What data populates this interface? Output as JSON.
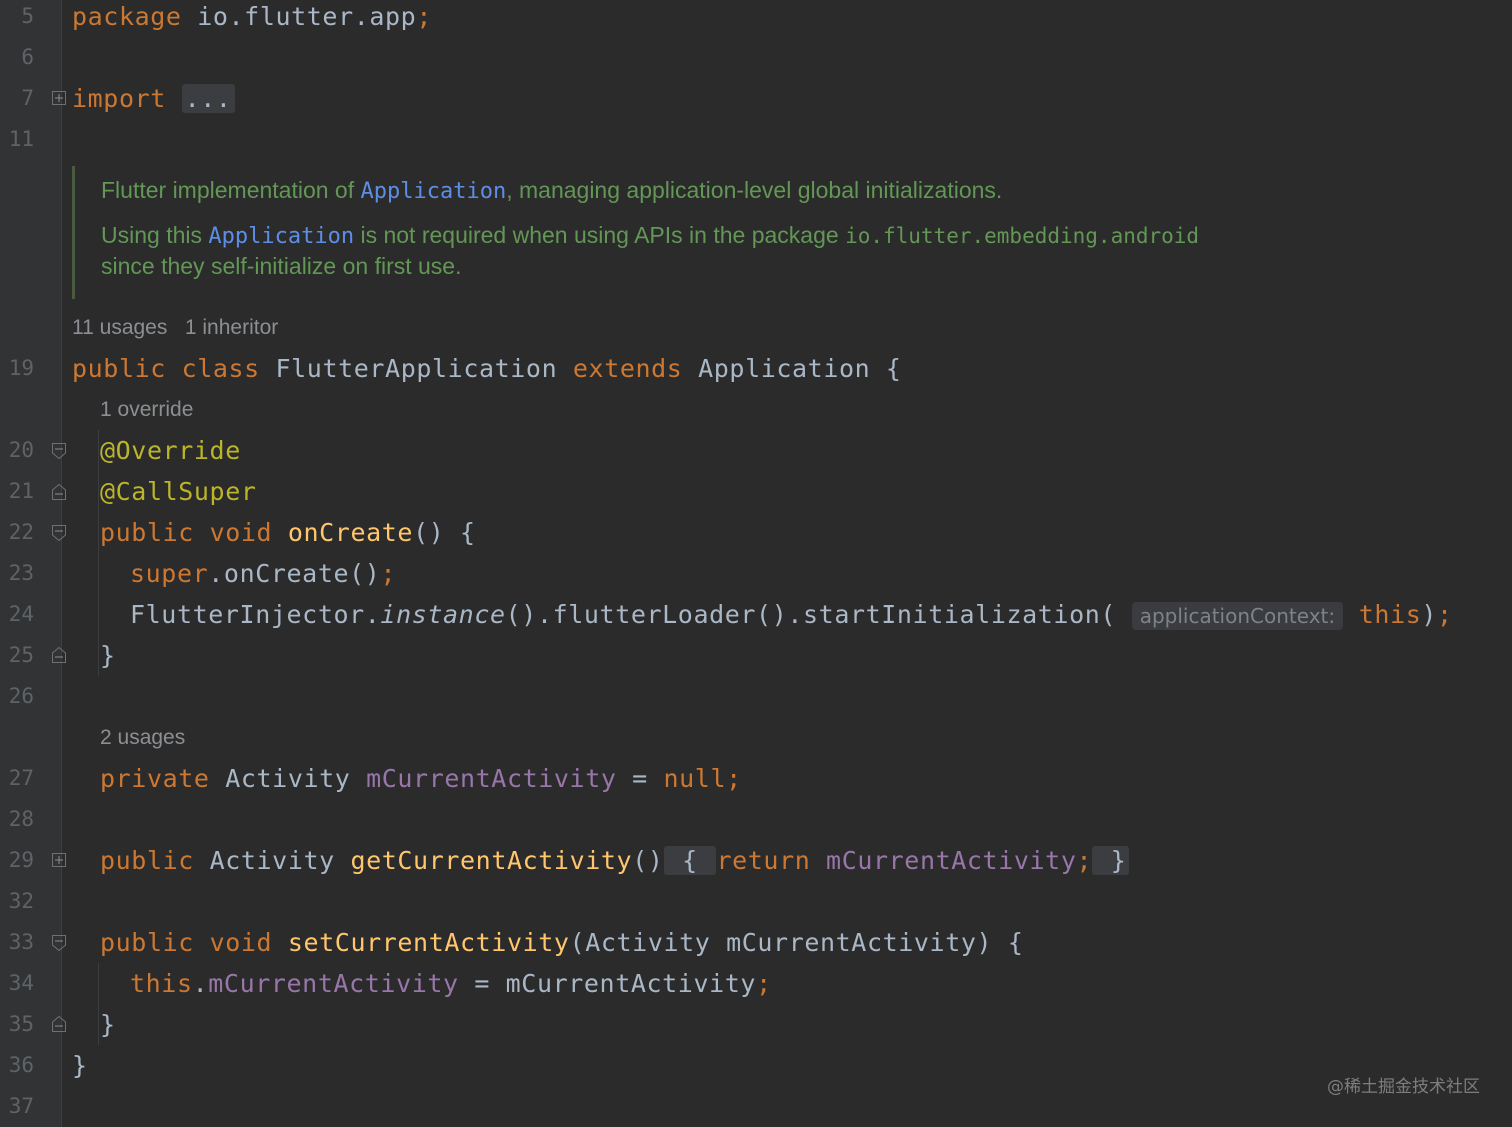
{
  "colors": {
    "background": "#2b2b2b",
    "gutter": "#313335",
    "keyword": "#cc7832",
    "annotation": "#bbb529",
    "function": "#ffc66d",
    "field": "#9876aa",
    "doc_comment": "#629755",
    "doc_link": "#5c8ee6",
    "text": "#a9b7c6"
  },
  "line_numbers": [
    "5",
    "6",
    "7",
    "11",
    "19",
    "20",
    "21",
    "22",
    "23",
    "24",
    "25",
    "26",
    "27",
    "28",
    "29",
    "32",
    "33",
    "34",
    "35",
    "36",
    "37"
  ],
  "code": {
    "l5": {
      "kw": "package",
      "rest": " io.flutter.app",
      "semi": ";"
    },
    "l7": {
      "kw": "import",
      "folded": "..."
    },
    "l19": {
      "kw1": "public",
      "kw2": "class",
      "name": "FlutterApplication",
      "kw3": "extends",
      "base": "Application {"
    },
    "l20": {
      "ann": "@Override"
    },
    "l21": {
      "ann": "@CallSuper"
    },
    "l22": {
      "kw1": "public",
      "kw2": "void",
      "fn": "onCreate",
      "rest": "() {"
    },
    "l23": {
      "kw": "super",
      "rest": ".onCreate()",
      "semi": ";"
    },
    "l24": {
      "a": "FlutterInjector.",
      "b": "instance",
      "c": "().flutterLoader().startInitialization(",
      "hint": "applicationContext:",
      "kw": "this",
      "d": ")",
      "semi": ";"
    },
    "l25": {
      "text": "}"
    },
    "l27": {
      "kw": "private",
      "type": "Activity",
      "field": "mCurrentActivity",
      "eq": " = ",
      "kw2": "null",
      "semi": ";"
    },
    "l29": {
      "kw": "public",
      "type": "Activity",
      "fn": "getCurrentActivity",
      "parens": "()",
      "open": " { ",
      "kw2": "return",
      "field": "mCurrentActivity",
      "semi": ";",
      "close": " }"
    },
    "l33": {
      "kw1": "public",
      "kw2": "void",
      "fn": "setCurrentActivity",
      "rest": "(Activity mCurrentActivity) {"
    },
    "l34": {
      "kw": "this",
      "dot": ".",
      "field": "mCurrentActivity",
      "rest": " = mCurrentActivity",
      "semi": ";"
    },
    "l35": {
      "text": "}"
    },
    "l36": {
      "text": "}"
    }
  },
  "doc": {
    "line1_a": "Flutter implementation of ",
    "line1_link": "Application",
    "line1_b": ", managing application-level global initializations.",
    "line2_a": "Using this ",
    "line2_link": "Application",
    "line2_b": " is not required when using APIs in the package ",
    "line2_code": "io.flutter.embedding.android",
    "line3": "since they self-initialize on first use."
  },
  "lens": {
    "class_usages": "11 usages",
    "class_inheritors": "1 inheritor",
    "override": "1 override",
    "field_usages": "2 usages"
  },
  "watermark": "@稀土掘金技术社区"
}
